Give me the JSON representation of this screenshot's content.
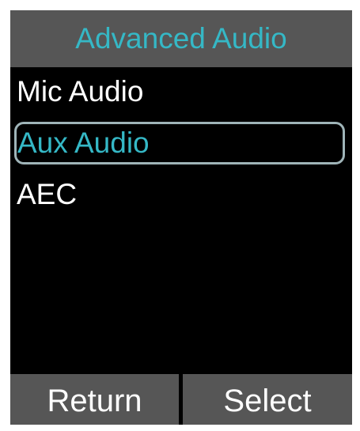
{
  "header": {
    "title": "Advanced Audio"
  },
  "menu": {
    "items": [
      {
        "label": "Mic Audio",
        "selected": false
      },
      {
        "label": "Aux Audio",
        "selected": true
      },
      {
        "label": "AEC",
        "selected": false
      }
    ]
  },
  "softkeys": {
    "left_label": "Return",
    "right_label": "Select"
  },
  "colors": {
    "accent": "#35b8c6",
    "bar_background": "#565656",
    "screen_background": "#000000",
    "text": "#ffffff",
    "selection_border": "#9fb4b8"
  }
}
